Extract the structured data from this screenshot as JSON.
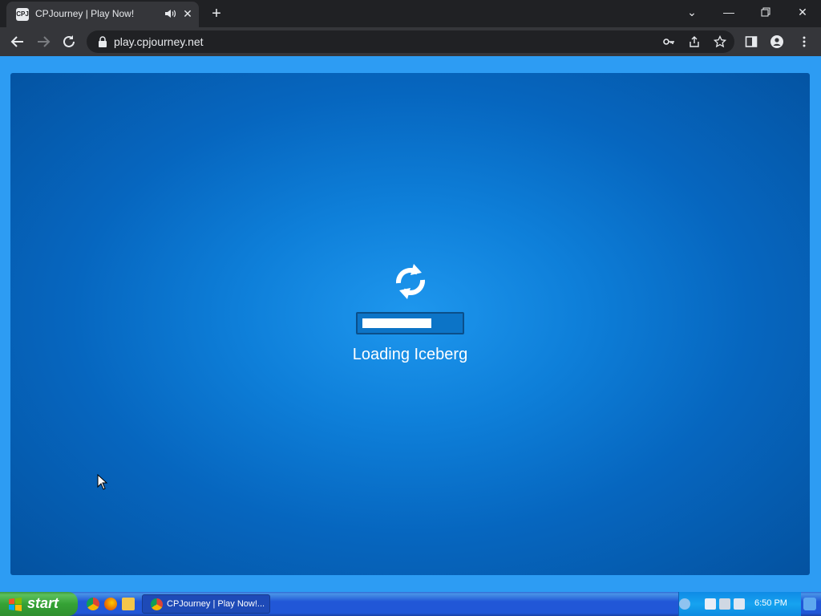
{
  "browser": {
    "tab": {
      "title": "CPJourney | Play Now!",
      "favicon_text": "CPJ"
    },
    "new_tab_icon": "plus-icon",
    "window_controls": [
      "minimize-icon",
      "restore-icon",
      "close-icon"
    ],
    "omnibox": {
      "url": "play.cpjourney.net"
    }
  },
  "game": {
    "loading_text": "Loading Iceberg",
    "progress": 0.72,
    "background_color": "#0b76d1"
  },
  "taskbar": {
    "start_label": "start",
    "task_button_label": "CPJourney | Play Now!...",
    "clock": "6:50 PM"
  }
}
